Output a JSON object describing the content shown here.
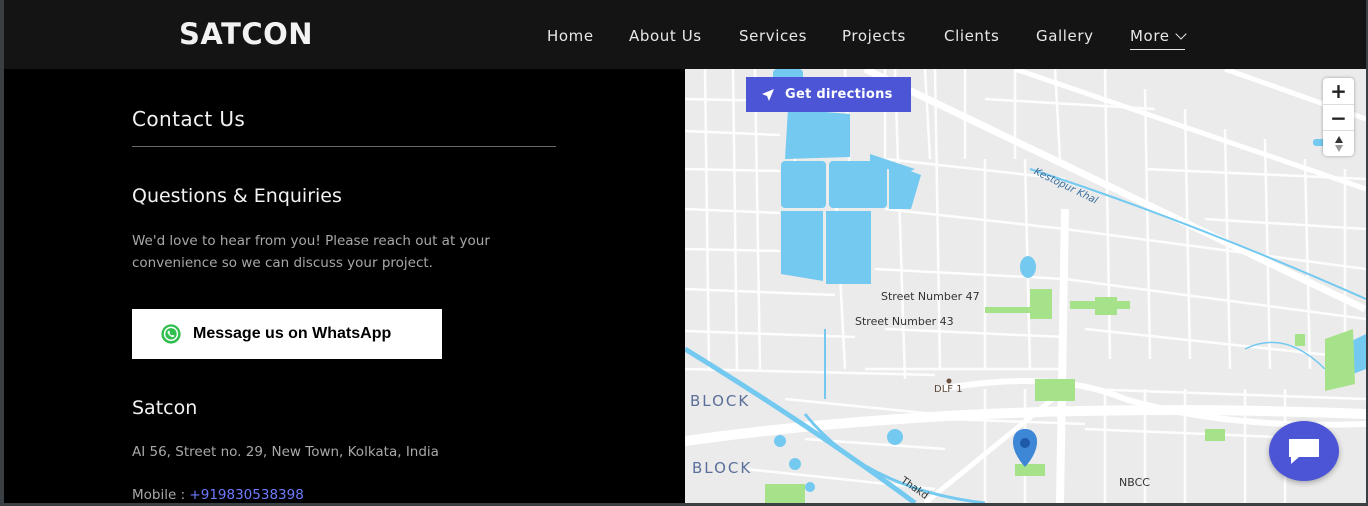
{
  "header": {
    "logo": "SATCON",
    "nav": [
      {
        "label": "Home"
      },
      {
        "label": "About Us"
      },
      {
        "label": "Services"
      },
      {
        "label": "Projects"
      },
      {
        "label": "Clients"
      },
      {
        "label": "Gallery"
      },
      {
        "label": "More"
      }
    ]
  },
  "contact": {
    "title": "Contact Us",
    "subheading": "Questions & Enquiries",
    "description": "We'd love to hear from you! Please reach out at your convenience so we can discuss your project.",
    "whatsapp_label": "Message us on WhatsApp",
    "company": "Satcon",
    "address": "AI 56, Street no. 29, New Town, Kolkata, India",
    "mobile_label": "Mobile :",
    "mobile_number": "+919830538398"
  },
  "map": {
    "directions_label": "Get directions",
    "zoom_in": "+",
    "zoom_out": "−",
    "labels": {
      "kestopur": "Kestopur Khal",
      "street47": "Street Number 47",
      "street43": "Street Number 43",
      "dlf": "DLF 1",
      "block1": "BLOCK",
      "block2": "BLOCK",
      "nbcc": "NBCC",
      "thakd": "Thakd"
    }
  },
  "colors": {
    "accent": "#4b55d6",
    "link": "#6d7cff",
    "water": "#74c9f0",
    "park": "#a6e28a"
  }
}
